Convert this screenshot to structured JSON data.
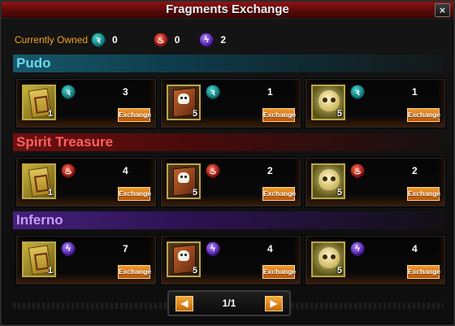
{
  "window": {
    "title": "Fragments Exchange",
    "close_label": "×"
  },
  "owned": {
    "label": "Currently Owned",
    "items": [
      {
        "icon": "pudo-fragment-icon",
        "count": "0"
      },
      {
        "icon": "spirit-fragment-icon",
        "count": "0"
      },
      {
        "icon": "inferno-fragment-icon",
        "count": "2"
      }
    ]
  },
  "sections": [
    {
      "title": "Pudo",
      "items": [
        {
          "item": "card",
          "stack": "1",
          "cost": "3",
          "button": "Exchange"
        },
        {
          "item": "skull-book",
          "stack": "5",
          "cost": "1",
          "button": "Exchange"
        },
        {
          "item": "golden-skull",
          "stack": "5",
          "cost": "1",
          "button": "Exchange"
        }
      ]
    },
    {
      "title": "Spirit Treasure",
      "items": [
        {
          "item": "card",
          "stack": "1",
          "cost": "4",
          "button": "Exchange"
        },
        {
          "item": "skull-book",
          "stack": "5",
          "cost": "2",
          "button": "Exchange"
        },
        {
          "item": "golden-skull",
          "stack": "5",
          "cost": "2",
          "button": "Exchange"
        }
      ]
    },
    {
      "title": "Inferno",
      "items": [
        {
          "item": "card",
          "stack": "1",
          "cost": "7",
          "button": "Exchange"
        },
        {
          "item": "skull-book",
          "stack": "5",
          "cost": "4",
          "button": "Exchange"
        },
        {
          "item": "golden-skull",
          "stack": "5",
          "cost": "4",
          "button": "Exchange"
        }
      ]
    }
  ],
  "pager": {
    "label": "1/1",
    "prev": "◀",
    "next": "▶"
  },
  "colors": {
    "accent": "#f09a2c",
    "pudo": "#6bd7ef",
    "spirit": "#ff6060",
    "inferno": "#c59cff"
  }
}
